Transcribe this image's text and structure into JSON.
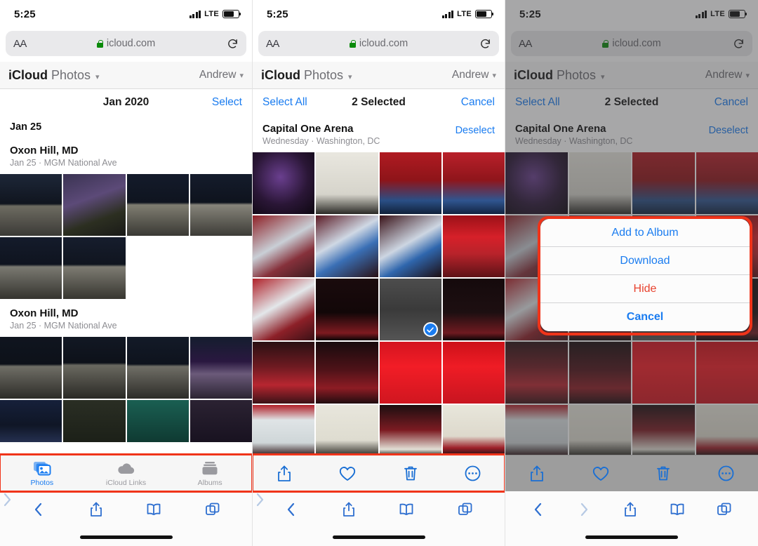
{
  "status_bar": {
    "time": "5:25",
    "network": "LTE",
    "signal_icon": "cellular-bars-icon",
    "battery_icon": "battery-icon"
  },
  "browser": {
    "text_size_button": "AA",
    "url": "icloud.com",
    "lock_icon": "lock-icon",
    "reload_icon": "reload-icon",
    "bottom_icons": [
      "back-chevron-icon",
      "forward-chevron-icon",
      "share-icon",
      "bookmarks-icon",
      "tabs-icon"
    ]
  },
  "app_header": {
    "brand_bold": "iCloud",
    "brand_light": "Photos",
    "chevron": "⌄",
    "account": "Andrew"
  },
  "panels": [
    {
      "id": "panel-browse",
      "nav": {
        "left_label": "",
        "title": "Jan 2020",
        "right_label": "Select"
      },
      "sections": [
        {
          "title": "Jan 25",
          "subtitle": "",
          "right_label": ""
        },
        {
          "title": "Oxon Hill, MD",
          "subtitle": "Jan 25 · MGM National Ave",
          "right_label": ""
        },
        {
          "title": "Oxon Hill, MD",
          "subtitle": "Jan 25 · MGM National Ave",
          "right_label": ""
        }
      ],
      "tabbar": {
        "highlighted": true,
        "tabs": [
          {
            "label": "Photos",
            "icon": "photos-icon",
            "active": true
          },
          {
            "label": "iCloud Links",
            "icon": "cloud-icon",
            "active": false
          },
          {
            "label": "Albums",
            "icon": "albums-icon",
            "active": false
          }
        ]
      }
    },
    {
      "id": "panel-selected",
      "nav": {
        "left_label": "Select All",
        "title": "2 Selected",
        "right_label": "Cancel"
      },
      "section": {
        "title": "Capital One Arena",
        "subtitle": "Wednesday · Washington, DC",
        "right_label": "Deselect"
      },
      "selected_count": 2,
      "check_icon": "checkmark-circle-icon",
      "actionbar": {
        "highlighted": true,
        "buttons": [
          {
            "name": "share-icon",
            "label": "Share"
          },
          {
            "name": "heart-icon",
            "label": "Favorite"
          },
          {
            "name": "trash-icon",
            "label": "Delete"
          },
          {
            "name": "more-ellipsis-icon",
            "label": "More"
          }
        ]
      }
    },
    {
      "id": "panel-actionsheet",
      "nav": {
        "left_label": "Select All",
        "title": "2 Selected",
        "right_label": "Cancel"
      },
      "section": {
        "title": "Capital One Arena",
        "subtitle": "Wednesday · Washington, DC",
        "right_label": "Deselect"
      },
      "dimmed": true,
      "action_sheet": {
        "highlighted": true,
        "options": [
          {
            "label": "Add to Album",
            "style": "default"
          },
          {
            "label": "Download",
            "style": "default"
          },
          {
            "label": "Hide",
            "style": "destructive"
          },
          {
            "label": "Cancel",
            "style": "cancel"
          }
        ]
      },
      "actionbar": {
        "highlighted": false,
        "buttons": [
          {
            "name": "share-icon",
            "label": "Share"
          },
          {
            "name": "heart-icon",
            "label": "Favorite"
          },
          {
            "name": "trash-icon",
            "label": "Delete"
          },
          {
            "name": "more-ellipsis-icon",
            "label": "More"
          }
        ]
      }
    }
  ],
  "colors": {
    "accent_blue": "#1a7cf0",
    "destructive_red": "#e8422e",
    "highlight_red": "#f0341a",
    "lock_green": "#0a8a0a"
  }
}
